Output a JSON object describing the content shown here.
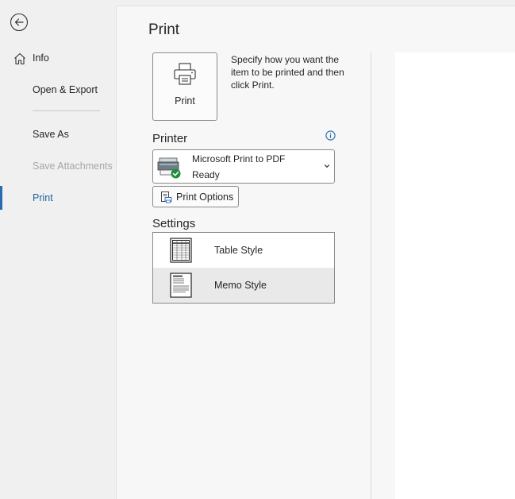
{
  "sidebar": {
    "items": [
      {
        "label": "Info"
      },
      {
        "label": "Open & Export"
      },
      {
        "label": "Save As"
      },
      {
        "label": "Save Attachments"
      },
      {
        "label": "Print"
      }
    ]
  },
  "main": {
    "title": "Print",
    "print_button_label": "Print",
    "print_description": "Specify how you want the item to be printed and then click Print.",
    "printer_section_label": "Printer",
    "printer": {
      "name": "Microsoft Print to PDF",
      "status": "Ready"
    },
    "print_options_label": "Print Options",
    "settings_label": "Settings",
    "styles": [
      {
        "label": "Table Style",
        "selected": false
      },
      {
        "label": "Memo Style",
        "selected": true
      }
    ]
  },
  "colors": {
    "accent": "#2b6cb0",
    "status_ok": "#1e8e3e"
  }
}
